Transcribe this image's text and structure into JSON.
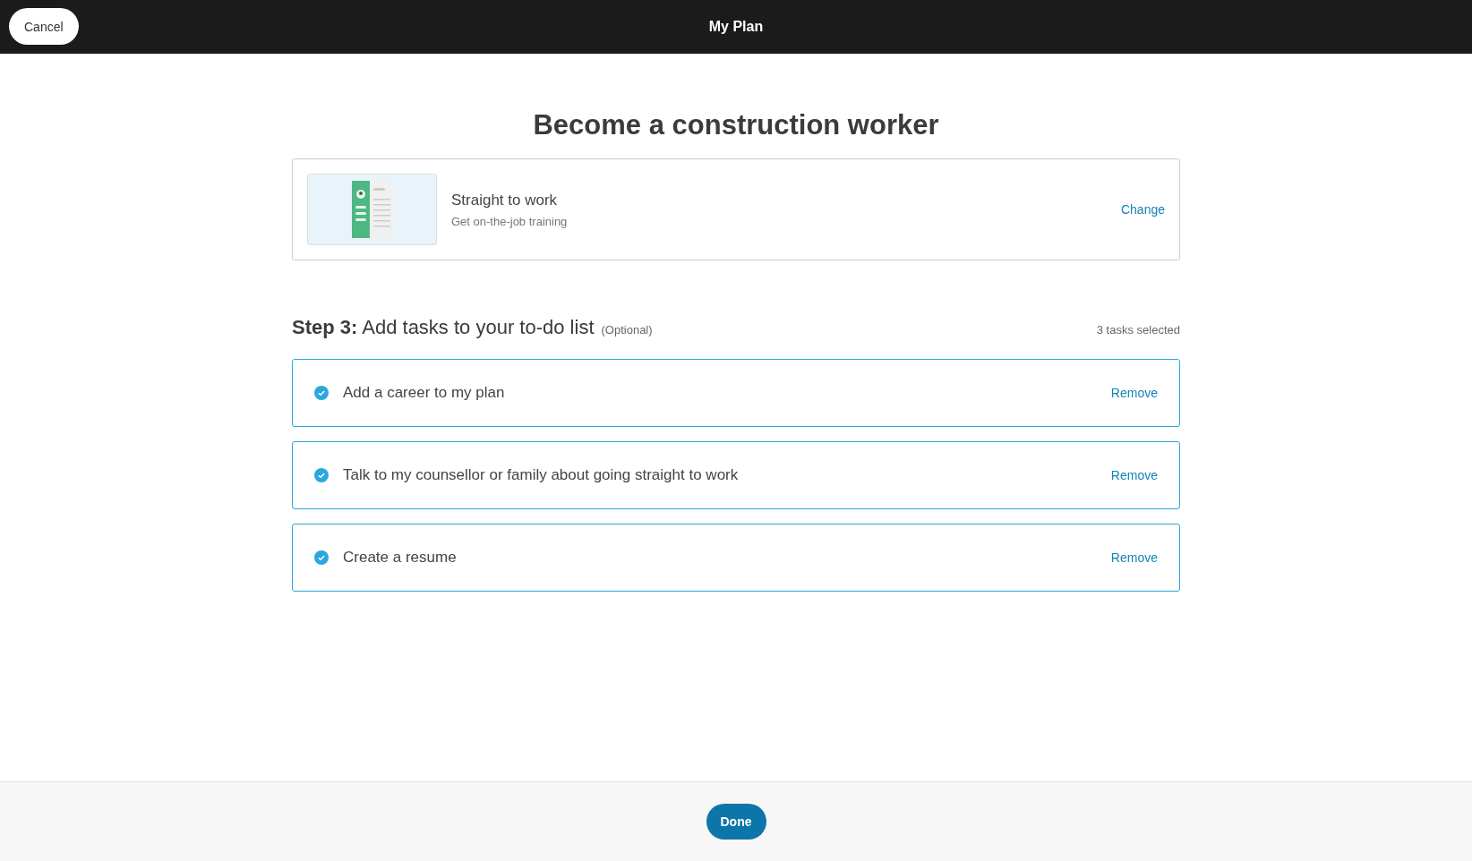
{
  "header": {
    "cancel": "Cancel",
    "title": "My Plan"
  },
  "goal": "Become a construction worker",
  "path": {
    "title": "Straight to work",
    "subtitle": "Get on-the-job training",
    "action": "Change"
  },
  "step": {
    "label": "**Step 3:** Add tasks to your to-do list",
    "note": "(Optional)",
    "count": "3 tasks selected"
  },
  "tasks": [
    {
      "label": "Add a career to my plan",
      "checked": true,
      "action": "Remove"
    },
    {
      "label": "Talk to my counsellor or family about going straight to work",
      "checked": true,
      "action": "Remove"
    },
    {
      "label": "Create a resume",
      "checked": true,
      "action": "Remove"
    }
  ],
  "footer": {
    "done": "Done"
  }
}
